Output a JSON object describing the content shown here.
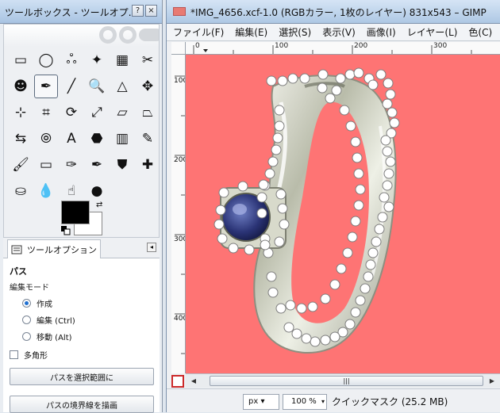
{
  "toolbox": {
    "title": "ツールボックス - ツールオプ…",
    "controls": [
      "?",
      "×"
    ],
    "tools": [
      "rect-select",
      "ellipse-select",
      "free-select",
      "fuzzy-select",
      "color-select",
      "scissors-select",
      "foreground-select",
      "paths",
      "color-picker",
      "zoom",
      "measure",
      "move",
      "align",
      "crop",
      "rotate",
      "scale",
      "shear",
      "perspective",
      "flip",
      "cage-transform",
      "text",
      "bucket-fill",
      "blend",
      "pencil",
      "paintbrush",
      "eraser",
      "airbrush",
      "ink",
      "clone",
      "heal",
      "perspective-clone",
      "blur-sharpen",
      "smudge",
      "dodge-burn"
    ],
    "tool_glyphs": [
      "▭",
      "◯",
      "ஃ",
      "✦",
      "▦",
      "✂",
      "☻",
      "✒",
      "╱",
      "🔍",
      "△",
      "✥",
      "⊹",
      "⌗",
      "⟳",
      "⤢",
      "▱",
      "⏢",
      "⇆",
      "⦾",
      "A",
      "⬣",
      "▥",
      "✎",
      "🖌",
      "▭",
      "✑",
      "✒",
      "⛊",
      "✚",
      "⛀",
      "💧",
      "☝",
      "●"
    ]
  },
  "options": {
    "tab_label": "ツールオプション",
    "tool_name": "パス",
    "mode_label": "編集モード",
    "modes": [
      "作成",
      "編集 (Ctrl)",
      "移動 (Alt)"
    ],
    "selected_mode": "作成",
    "polygon_label": "多角形",
    "btn_selection": "パスを選択範囲に",
    "btn_stroke": "パスの境界線を描画"
  },
  "image_window": {
    "title": "*IMG_4656.xcf-1.0 (RGBカラー, 1枚のレイヤー) 831x543 – GIMP",
    "menus": [
      "ファイル(F)",
      "編集(E)",
      "選択(S)",
      "表示(V)",
      "画像(I)",
      "レイヤー(L)",
      "色(C)"
    ],
    "ruler_h_labels": [
      "0",
      "100",
      "200",
      "300"
    ],
    "ruler_v_labels": [
      "100",
      "200",
      "300",
      "400"
    ],
    "canvas_color": "#fe7474"
  },
  "status": {
    "unit": "px",
    "zoom": "100 %",
    "text": "クイックマスク (25.2 MB)"
  },
  "scroll": {
    "thumb_label": "|||"
  }
}
